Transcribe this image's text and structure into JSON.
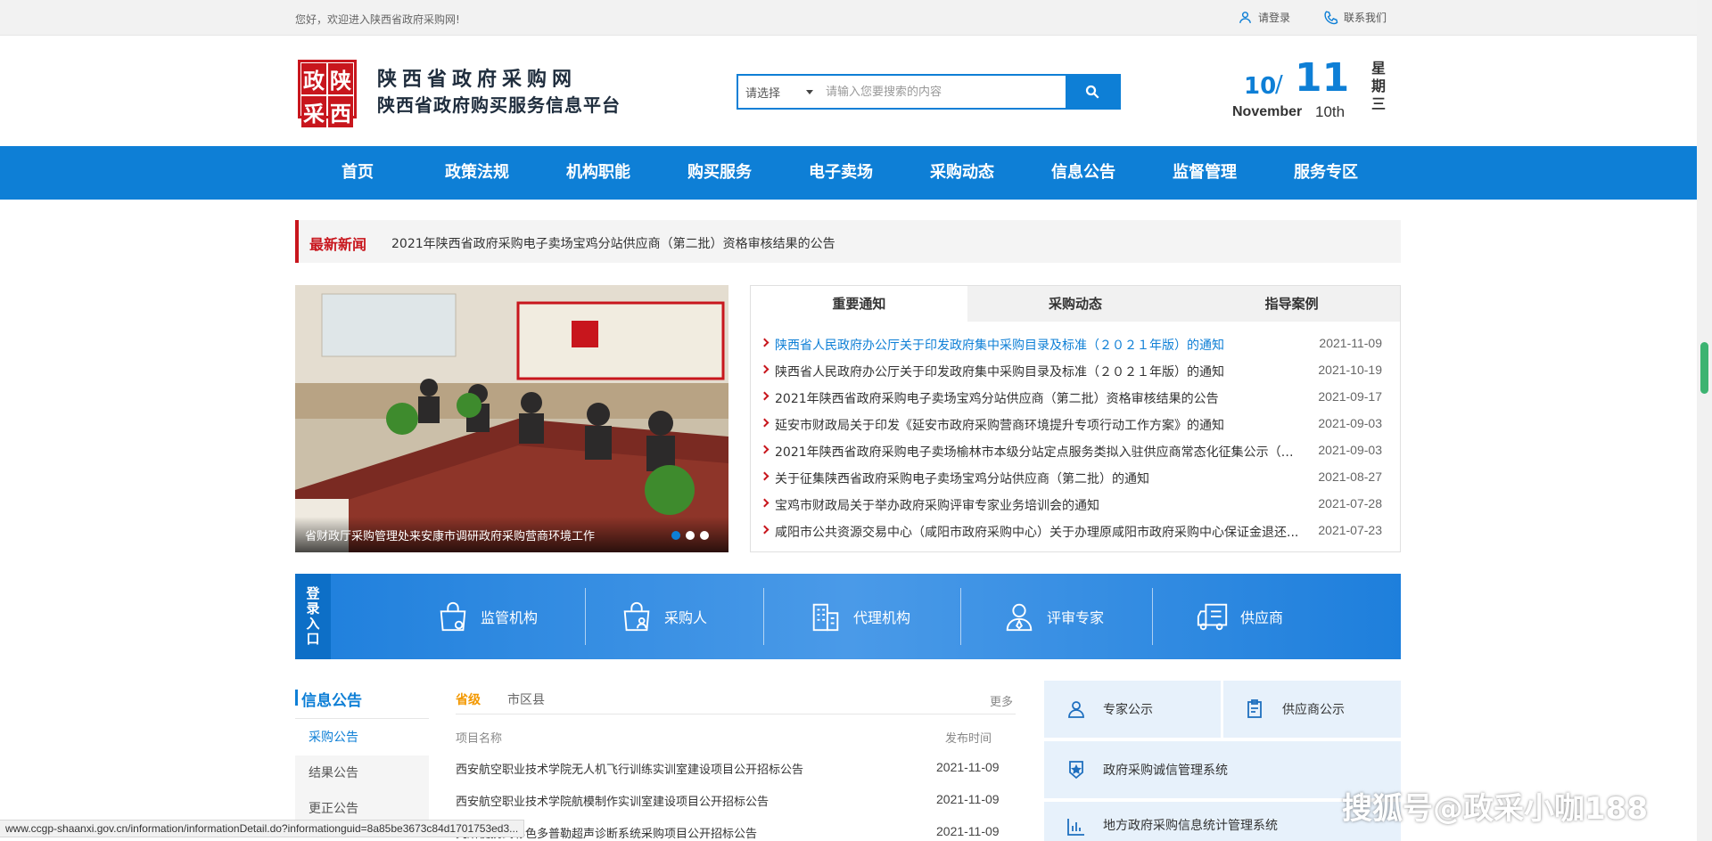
{
  "topbar": {
    "welcome": "您好，欢迎进入陕西省政府采购网!",
    "login": "请登录",
    "contact": "联系我们"
  },
  "header": {
    "logo_chars": [
      "政",
      "陕",
      "采",
      "西"
    ],
    "site_name": "陕西省政府采购网",
    "site_subtitle": "陕西省政府购买服务信息平台",
    "search_select": "请选择",
    "search_placeholder": "请输入您要搜索的内容",
    "date": {
      "month": "10",
      "slash": "/",
      "day": "11",
      "month_name": "November",
      "ordinal": "10th",
      "weekday": "星期三"
    }
  },
  "nav": [
    "首页",
    "政策法规",
    "机构职能",
    "购买服务",
    "电子卖场",
    "采购动态",
    "信息公告",
    "监督管理",
    "服务专区"
  ],
  "latest_news": {
    "label": "最新新闻",
    "text": "2021年陕西省政府采购电子卖场宝鸡分站供应商（第二批）资格审核结果的公告"
  },
  "carousel": {
    "caption": "省财政厅采购管理处来安康市调研政府采购营商环境工作",
    "dots": 3,
    "active_dot": 0
  },
  "panel": {
    "tabs": [
      "重要通知",
      "采购动态",
      "指导案例"
    ],
    "active_tab": 0,
    "items": [
      {
        "title": "陕西省人民政府办公厅关于印发政府集中采购目录及标准（２０２１年版）的通知",
        "date": "2021-11-09",
        "highlight": true
      },
      {
        "title": "陕西省人民政府办公厅关于印发政府集中采购目录及标准（２０２１年版）的通知",
        "date": "2021-10-19",
        "highlight": false
      },
      {
        "title": "2021年陕西省政府采购电子卖场宝鸡分站供应商（第二批）资格审核结果的公告",
        "date": "2021-09-17",
        "highlight": false
      },
      {
        "title": "延安市财政局关于印发《延安市政府采购营商环境提升专项行动工作方案》的通知",
        "date": "2021-09-03",
        "highlight": false
      },
      {
        "title": "2021年陕西省政府采购电子卖场榆林市本级分站定点服务类拟入驻供应商常态化征集公示（第...",
        "date": "2021-09-03",
        "highlight": false
      },
      {
        "title": "关于征集陕西省政府采购电子卖场宝鸡分站供应商（第二批）的通知",
        "date": "2021-08-27",
        "highlight": false
      },
      {
        "title": "宝鸡市财政局关于举办政府采购评审专家业务培训会的通知",
        "date": "2021-07-28",
        "highlight": false
      },
      {
        "title": "咸阳市公共资源交易中心（咸阳市政府采购中心）关于办理原咸阳市政府采购中心保证金退还...",
        "date": "2021-07-23",
        "highlight": false
      }
    ]
  },
  "entry": {
    "label": "登录入口",
    "items": [
      {
        "label": "监管机构",
        "icon": "bag-lock-icon"
      },
      {
        "label": "采购人",
        "icon": "bag-user-icon"
      },
      {
        "label": "代理机构",
        "icon": "building-icon"
      },
      {
        "label": "评审专家",
        "icon": "expert-icon"
      },
      {
        "label": "供应商",
        "icon": "truck-icon"
      }
    ]
  },
  "info": {
    "title": "信息公告",
    "side_menu": [
      "采购公告",
      "结果公告",
      "更正公告"
    ],
    "sub_tabs": [
      "省级",
      "市区县"
    ],
    "more": "更多",
    "col_name": "项目名称",
    "col_date": "发布时间",
    "rows": [
      {
        "title": "西安航空职业技术学院无人机飞行训练实训室建设项目公开招标公告",
        "date": "2021-11-09"
      },
      {
        "title": "西安航空职业技术学院航模制作实训室建设项目公开招标公告",
        "date": "2021-11-09"
      },
      {
        "title": "究所便携式彩色多普勒超声诊断系统采购项目公开招标公告",
        "date": "2021-11-09"
      }
    ]
  },
  "quick_links": [
    {
      "label": "专家公示",
      "icon": "expert-icon"
    },
    {
      "label": "供应商公示",
      "icon": "clipboard-icon"
    },
    {
      "label": "政府采购诚信管理系统",
      "icon": "shield-star-icon"
    },
    {
      "label": "地方政府采购信息统计管理系统",
      "icon": "bar-chart-icon"
    }
  ],
  "status_url": "www.ccgp-shaanxi.gov.cn/information/informationDetail.do?informationguid=8a85be3673c84d1701753ed3...",
  "watermark": "搜狐号@政采小咖188",
  "colors": {
    "primary": "#0e7fd6",
    "red": "#c8161d",
    "orange": "#f39800"
  }
}
